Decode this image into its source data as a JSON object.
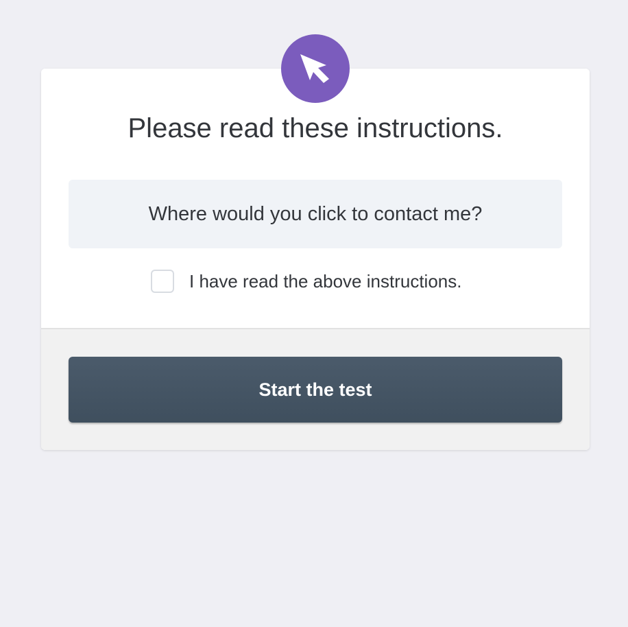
{
  "header": {
    "icon": "cursor-arrow-icon",
    "title": "Please read these instructions."
  },
  "task": {
    "question": "Where would you click to contact me?"
  },
  "confirm": {
    "label": "I have read the above instructions.",
    "checked": false
  },
  "actions": {
    "start_label": "Start the test"
  },
  "colors": {
    "accent": "#7b5cbd",
    "button": "#46566a",
    "background": "#efeff4"
  }
}
